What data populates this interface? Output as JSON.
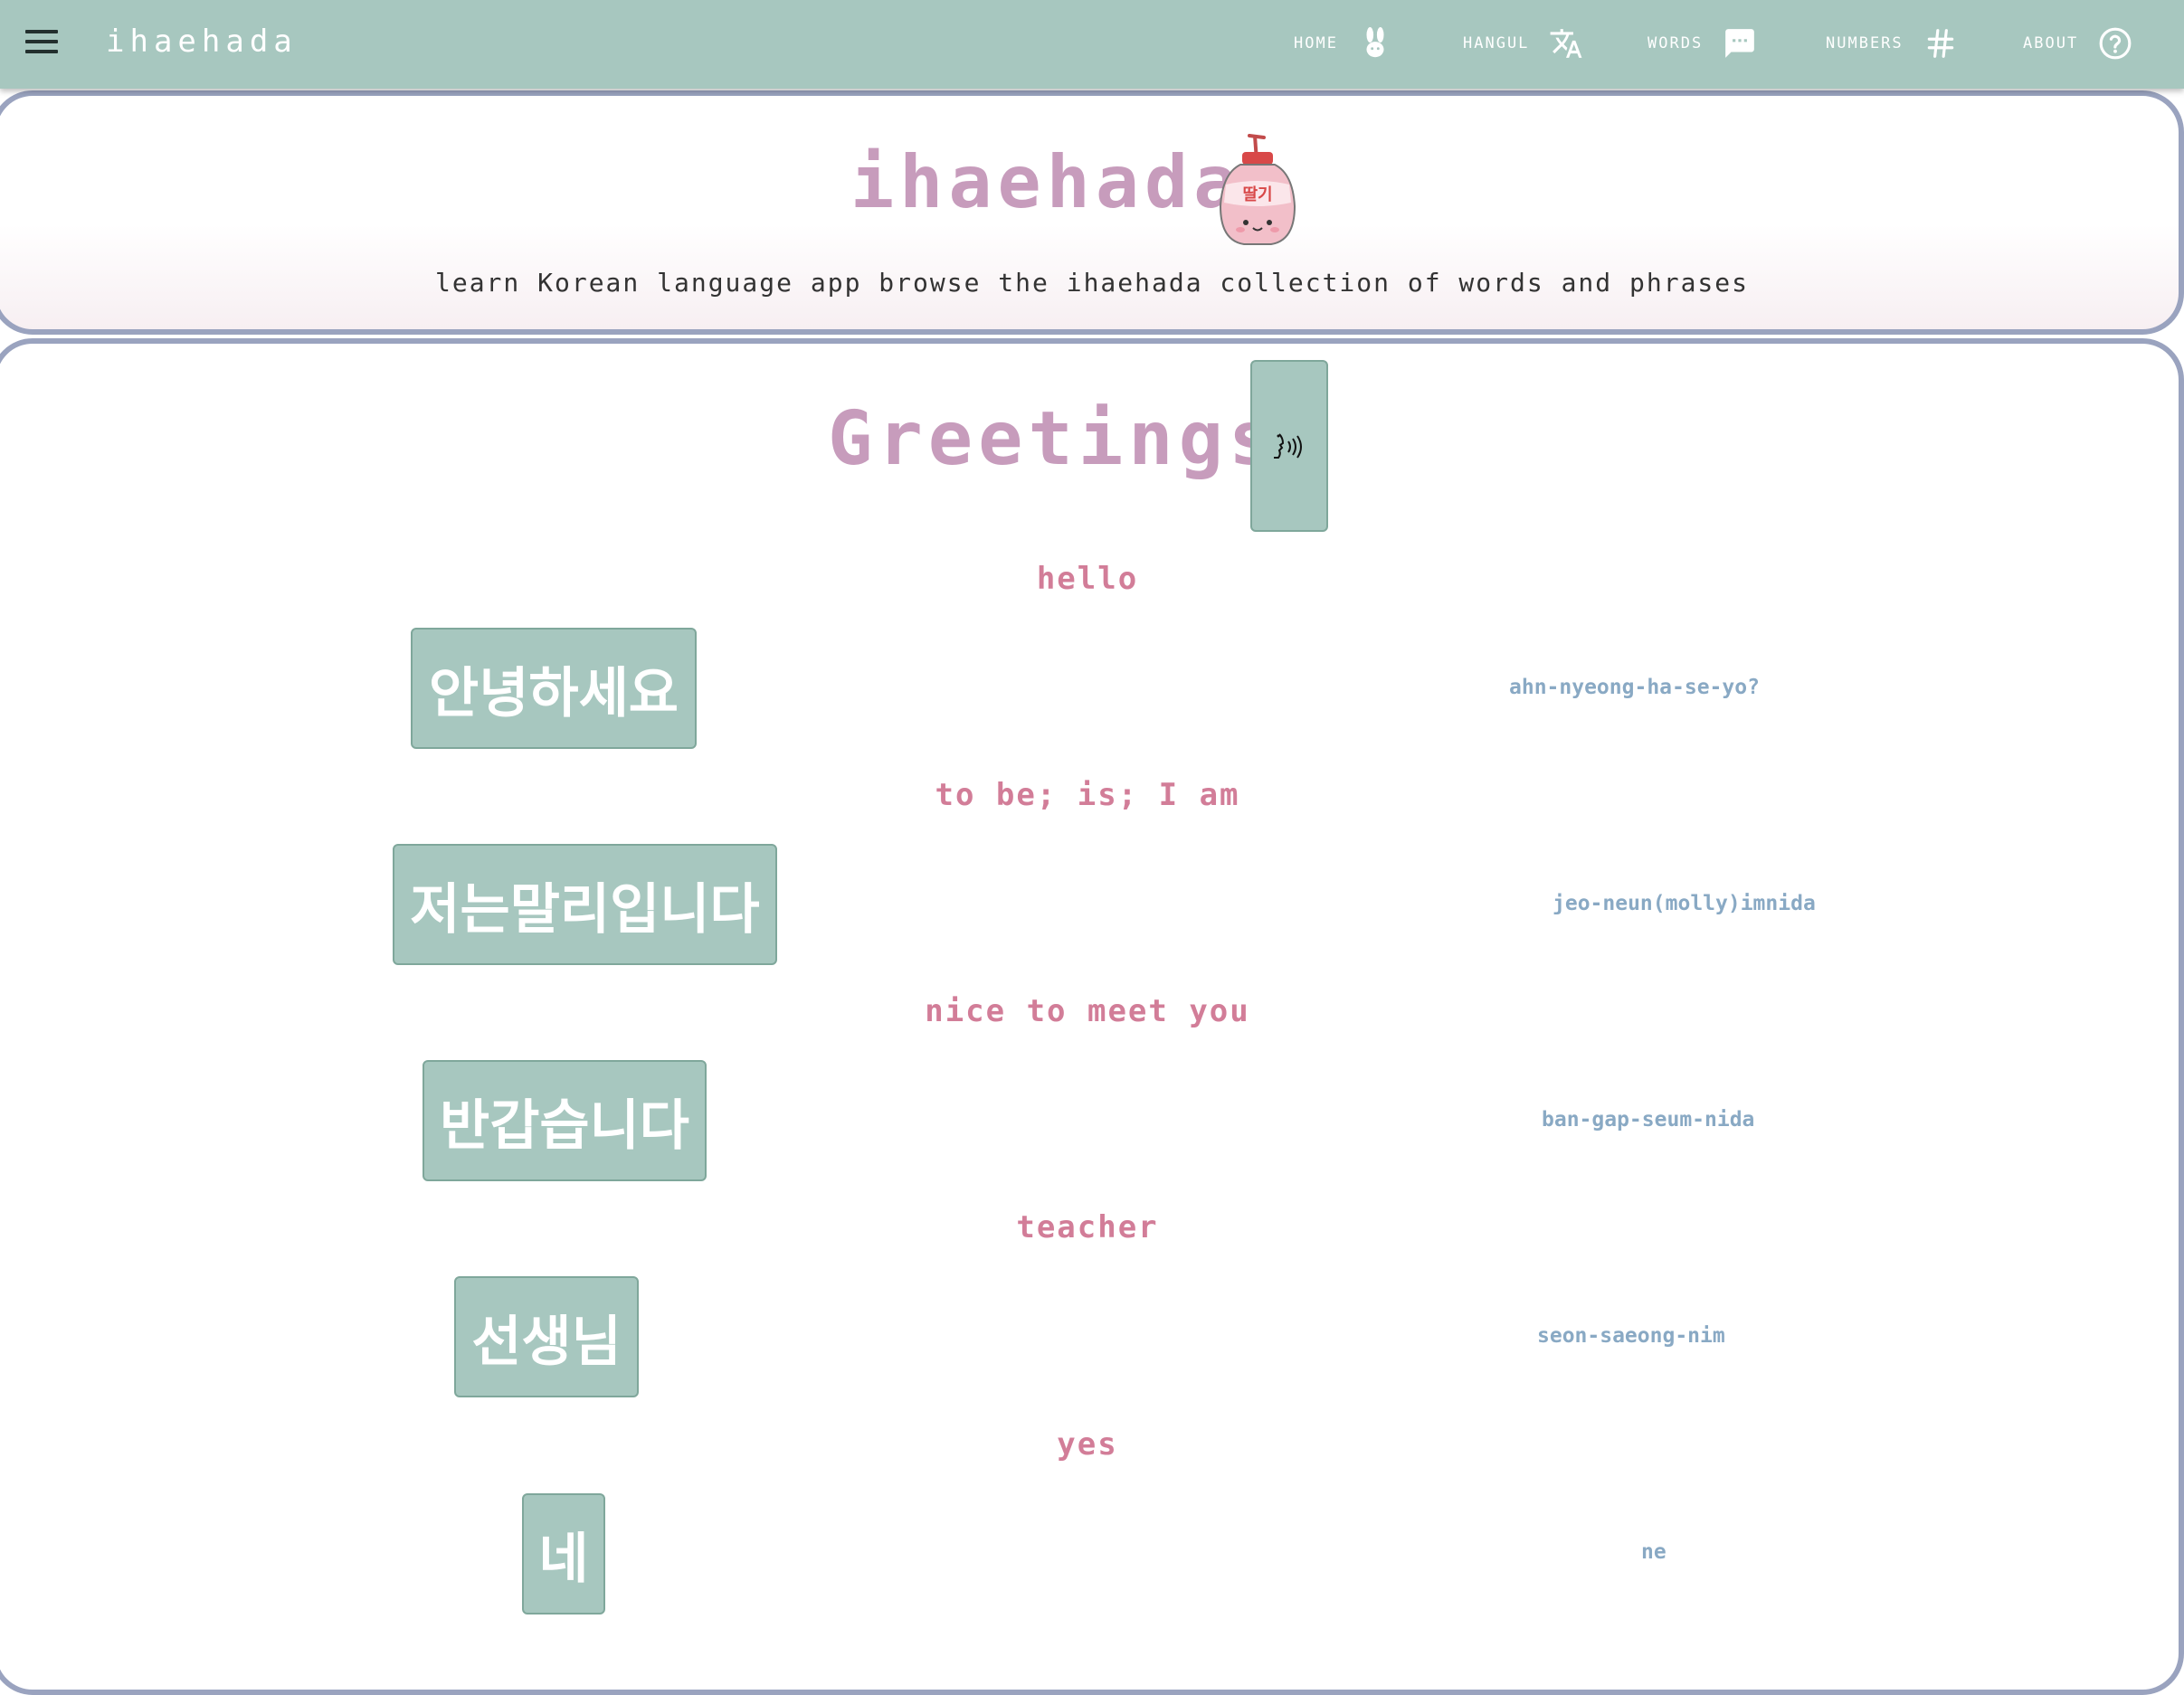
{
  "nav": {
    "brand": "ihaehada",
    "items": [
      {
        "label": "HOME",
        "icon": "rabbit-icon"
      },
      {
        "label": "HANGUL",
        "icon": "translate-icon"
      },
      {
        "label": "WORDS",
        "icon": "chat-icon"
      },
      {
        "label": "NUMBERS",
        "icon": "hash-icon"
      },
      {
        "label": "ABOUT",
        "icon": "help-circle-icon"
      }
    ]
  },
  "header": {
    "title": "ihaehada",
    "logo_text": "딸기",
    "tagline": "learn Korean language app browse the ihaehada collection of words and phrases"
  },
  "section": {
    "title": "Greetings",
    "speak_icon": "speaking-head-icon"
  },
  "phrases": [
    {
      "english": "hello",
      "korean": "안녕하세요",
      "romanization": "ahn-nyeong-ha-se-yo?"
    },
    {
      "english": "to be; is; I am",
      "korean": "저는말리입니다",
      "romanization": "jeo-neun(molly)imnida"
    },
    {
      "english": "nice to meet you",
      "korean": "반갑습니다",
      "romanization": "ban-gap-seum-nida"
    },
    {
      "english": "teacher",
      "korean": "선생님",
      "romanization": "seon-saeong-nim"
    },
    {
      "english": "yes",
      "korean": "네",
      "romanization": "ne"
    }
  ],
  "colors": {
    "nav_bg": "#a7c7bf",
    "title": "#c79cbc",
    "english": "#d27d98",
    "romanization": "#89a9c4",
    "card_border": "#9aa3bf"
  }
}
